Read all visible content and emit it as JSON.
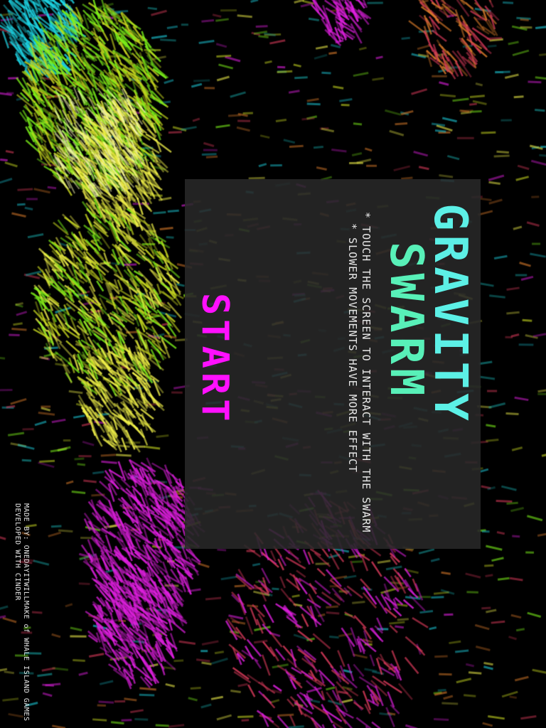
{
  "game": {
    "title_line_1": "GRAVITY",
    "title_line_2": "SWARM",
    "instructions": [
      "* TOUCH THE SCREEN TO INTERACT WITH THE SWARM",
      "* SLOWER MOVEMENTS HAVE MORE EFFECT"
    ],
    "start_label": "START",
    "credits": [
      "MADE BY: ONEDAYITWILLMAKE of WHALE ISLAND GAMES",
      "DEVELOPED WITH CINDER"
    ]
  },
  "colors": {
    "background": "#000000",
    "panel": "#282828",
    "title_line_1": "#5cf0e6",
    "title_line_2": "#58f0b8",
    "start": "#ff10ff",
    "text": "#e8e8e8"
  },
  "swarm_palette": [
    "#1ed6e6",
    "#7cf21a",
    "#f2f24a",
    "#c8d820",
    "#e020e0",
    "#d83a5a",
    "#18a0a0",
    "#d87a2a"
  ]
}
